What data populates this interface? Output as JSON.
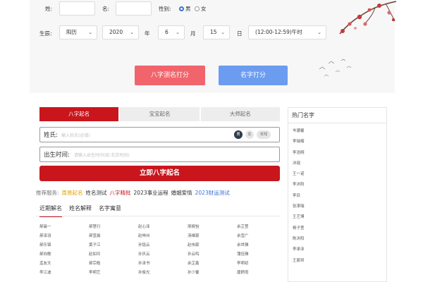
{
  "form": {
    "surname_label": "姓:",
    "name_label": "名:",
    "gender_label": "性别:",
    "gender_male": "男",
    "gender_female": "女",
    "birth_label": "生辰:",
    "calendar_value": "阳历",
    "year_value": "2020",
    "year_unit": "年",
    "month_value": "6",
    "month_unit": "月",
    "day_value": "15",
    "day_unit": "日",
    "hour_value": "(12:00-12:59)午时",
    "score_button": "八字测名打分",
    "name_score_button": "名字打分"
  },
  "naming": {
    "tabs": [
      "八字起名",
      "宝宝起名",
      "大师起名"
    ],
    "surname_label": "姓氏:",
    "surname_placeholder": "输入姓氏(必填)",
    "gender_pills": [
      "男",
      "女",
      "未知"
    ],
    "birth_label": "出生时间:",
    "birth_placeholder": "请输入出生时间(如:北京时间)",
    "submit_button": "立即八字起名"
  },
  "recommend": {
    "label": "推荐服务:",
    "links": [
      {
        "text": "周易起名",
        "color": "#e0a100"
      },
      {
        "text": "姓名测试",
        "color": "#333333"
      },
      {
        "text": "八字精批",
        "color": "#c9161d"
      },
      {
        "text": "2023事业运程",
        "color": "#333333"
      },
      {
        "text": "婚姻爱情",
        "color": "#333333"
      },
      {
        "text": "2023财运测试",
        "color": "#3b6fd8"
      }
    ]
  },
  "subtabs": [
    "近期解名",
    "姓名解释",
    "名字寓意"
  ],
  "recent_names": [
    "郝晨一",
    "郝慧行",
    "赵心泽",
    "邢婉怡",
    "余芷萱",
    "郝泽羽",
    "郝宣晨",
    "赵林州",
    "汤维宸",
    "余宜广",
    "郝乐锦",
    "黄子江",
    "孙铭云",
    "赵伟宸",
    "余世雅",
    "郝向歌",
    "赵如玲",
    "孙庆云",
    "孙云鸣",
    "蒲佳雅",
    "孟友文",
    "郝宗皓",
    "孙泽书",
    "余芷鑫",
    "李明初",
    "李江迪",
    "李明艺",
    "孙俊光",
    "孙少馨",
    "唐舒雨"
  ],
  "sidebar": {
    "title": "热门名字",
    "items": [
      "岑骢馨",
      "李瑞楠",
      "李浩翔",
      "沐瑶",
      "王一诺",
      "李沐阳",
      "李目",
      "张津瑞",
      "王艺博",
      "杨子萱",
      "陈沐阳",
      "李承泽",
      "王宸珂"
    ]
  },
  "colors": {
    "accent": "#c9161d",
    "score_button": "#f2646c",
    "name_score_button": "#6b9cf0",
    "radio_active": "#3b6fd8"
  }
}
